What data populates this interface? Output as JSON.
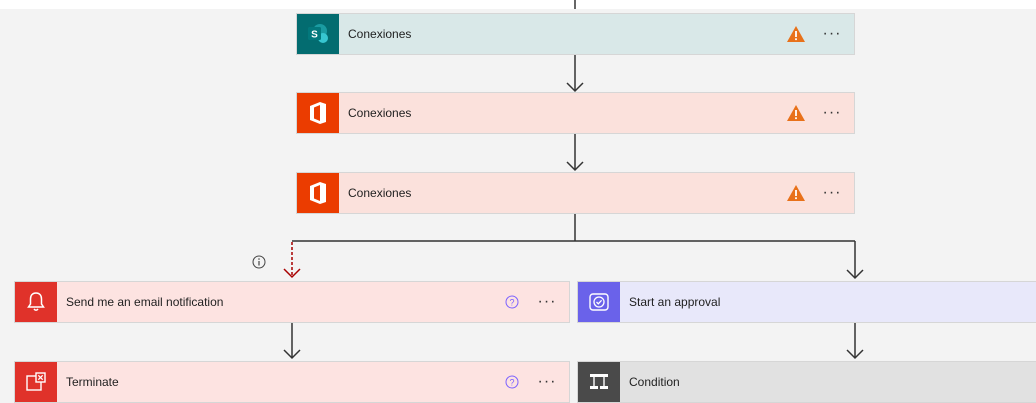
{
  "flow": {
    "steps": [
      {
        "label": "Conexiones",
        "icon": "sharepoint-icon",
        "color": "#036c70",
        "warning": true
      },
      {
        "label": "Conexiones",
        "icon": "office-icon",
        "color": "#eb3c00",
        "warning": true
      },
      {
        "label": "Conexiones",
        "icon": "office-icon",
        "color": "#eb3c00",
        "warning": true
      }
    ],
    "left_branch": [
      {
        "label": "Send me an email notification",
        "icon": "bell-icon",
        "color": "#e0322a"
      },
      {
        "label": "Terminate",
        "icon": "terminate-icon",
        "color": "#e0322a"
      }
    ],
    "right_branch": [
      {
        "label": "Start an approval",
        "icon": "approval-icon",
        "color": "#6a62ea"
      },
      {
        "label": "Condition",
        "icon": "condition-icon",
        "color": "#4a4a4a"
      }
    ]
  },
  "colors": {
    "warning": "#e8711a",
    "help": "#7b61ff",
    "arrow": "#333333",
    "error_arrow": "#a80000"
  }
}
